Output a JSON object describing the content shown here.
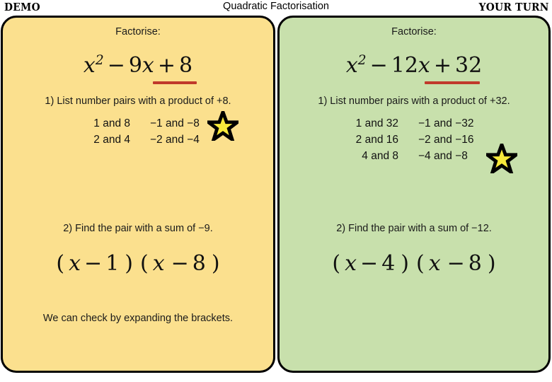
{
  "header": {
    "demo_badge": "DEMO",
    "title": "Quadratic Factorisation",
    "your_turn_badge": "YOUR TURN"
  },
  "colors": {
    "demo_panel_bg": "#FBE08E",
    "your_turn_panel_bg": "#C8E0AC",
    "panel_border": "#000000",
    "underline_red": "#C0392B",
    "star_fill": "#F7E93B",
    "star_outline": "#000000"
  },
  "demo_panel": {
    "prompt": "Factorise:",
    "equation": {
      "variable": "x",
      "exponent": "2",
      "middle_op": "−",
      "middle_coefficient": "9",
      "middle_variable": "x",
      "constant_op": "+",
      "constant": "8"
    },
    "step1": "1) List number pairs with a product of +8.",
    "pairs": [
      {
        "positive": "1  and 8",
        "negative": "−1  and −8",
        "starred": true
      },
      {
        "positive": "2  and 4",
        "negative": "−2  and −4",
        "starred": false
      }
    ],
    "step2": "2) Find the pair with a sum of −9.",
    "answer": {
      "factor1_variable": "x",
      "factor1_op": "−",
      "factor1_constant": "1",
      "factor2_variable": "x",
      "factor2_op": "−",
      "factor2_constant": "8"
    },
    "note": "We can check by expanding the brackets."
  },
  "your_turn_panel": {
    "prompt": "Factorise:",
    "equation": {
      "variable": "x",
      "exponent": "2",
      "middle_op": "−",
      "middle_coefficient": "12",
      "middle_variable": "x",
      "constant_op": "+",
      "constant": "32"
    },
    "step1": "1) List number pairs with a product of +32.",
    "pairs": [
      {
        "positive": "1  and 32",
        "negative": "−1  and −32",
        "starred": false
      },
      {
        "positive": "2  and 16",
        "negative": "−2  and −16",
        "starred": false
      },
      {
        "positive": "4  and 8",
        "negative": "−4  and −8",
        "starred": true
      }
    ],
    "step2": "2) Find the pair with a sum of −12.",
    "answer": {
      "factor1_variable": "x",
      "factor1_op": "−",
      "factor1_constant": "4",
      "factor2_variable": "x",
      "factor2_op": "−",
      "factor2_constant": "8"
    }
  }
}
